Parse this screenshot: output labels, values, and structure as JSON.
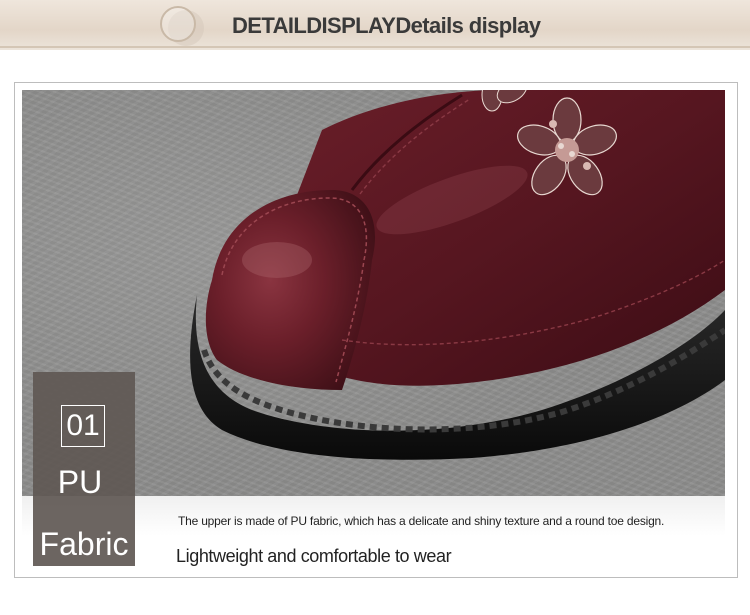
{
  "header": {
    "title": "DETAILDISPLAYDetails display"
  },
  "photo": {
    "subject": "shoe-toe-closeup",
    "colors": {
      "leather": "#5e1a22",
      "sole": "#141414",
      "background": "#8d8d8c",
      "accent_banner": "#e6dace"
    }
  },
  "feature": {
    "number": "01",
    "label_line1": "PU",
    "label_line2": "Fabric"
  },
  "description": {
    "text": "The upper is made of PU fabric, which has a delicate and shiny texture and a round toe design.",
    "tagline": "Lightweight and comfortable to wear"
  }
}
